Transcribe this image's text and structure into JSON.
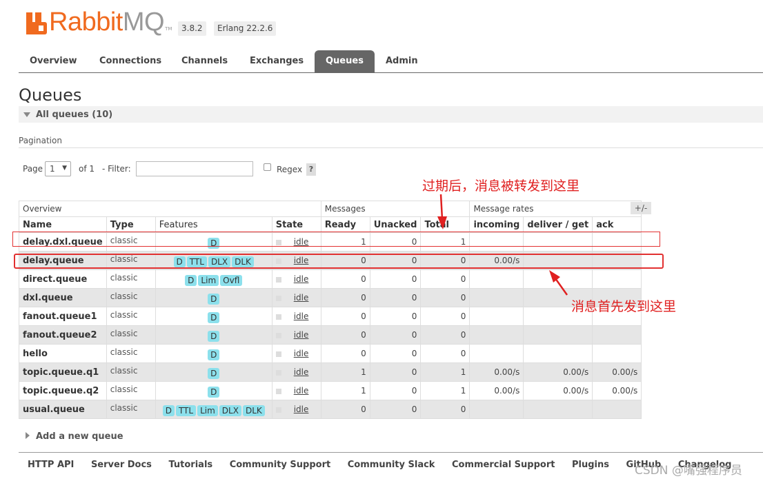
{
  "header": {
    "logo_rabbit": "Rabbit",
    "logo_mq": "MQ",
    "logo_tm": "TM",
    "version": "3.8.2",
    "erlang": "Erlang 22.2.6"
  },
  "tabs": [
    "Overview",
    "Connections",
    "Channels",
    "Exchanges",
    "Queues",
    "Admin"
  ],
  "active_tab": "Queues",
  "page_title": "Queues",
  "section": {
    "title": "All queues (10)"
  },
  "pagination": {
    "label": "Pagination",
    "page_label": "Page",
    "page_value": "1",
    "of_label": "of 1",
    "filter_label": "- Filter:",
    "filter_value": "",
    "regex_label": "Regex",
    "help": "?"
  },
  "table": {
    "groups": [
      "Overview",
      "Messages",
      "Message rates"
    ],
    "plus_minus": "+/-",
    "headers": [
      "Name",
      "Type",
      "Features",
      "State",
      "Ready",
      "Unacked",
      "Total",
      "incoming",
      "deliver / get",
      "ack"
    ],
    "rows": [
      {
        "name": "delay.dxl.queue",
        "type": "classic",
        "features": [
          "D"
        ],
        "state": "idle",
        "ready": "1",
        "unacked": "0",
        "total": "1",
        "incoming": "",
        "deliver": "",
        "ack": ""
      },
      {
        "name": "delay.queue",
        "type": "classic",
        "features": [
          "D",
          "TTL",
          "DLX",
          "DLK"
        ],
        "state": "idle",
        "ready": "0",
        "unacked": "0",
        "total": "0",
        "incoming": "0.00/s",
        "deliver": "",
        "ack": ""
      },
      {
        "name": "direct.queue",
        "type": "classic",
        "features": [
          "D",
          "Lim",
          "Ovfl"
        ],
        "state": "idle",
        "ready": "0",
        "unacked": "0",
        "total": "0",
        "incoming": "",
        "deliver": "",
        "ack": ""
      },
      {
        "name": "dxl.queue",
        "type": "classic",
        "features": [
          "D"
        ],
        "state": "idle",
        "ready": "0",
        "unacked": "0",
        "total": "0",
        "incoming": "",
        "deliver": "",
        "ack": ""
      },
      {
        "name": "fanout.queue1",
        "type": "classic",
        "features": [
          "D"
        ],
        "state": "idle",
        "ready": "0",
        "unacked": "0",
        "total": "0",
        "incoming": "",
        "deliver": "",
        "ack": ""
      },
      {
        "name": "fanout.queue2",
        "type": "classic",
        "features": [
          "D"
        ],
        "state": "idle",
        "ready": "0",
        "unacked": "0",
        "total": "0",
        "incoming": "",
        "deliver": "",
        "ack": ""
      },
      {
        "name": "hello",
        "type": "classic",
        "features": [
          "D"
        ],
        "state": "idle",
        "ready": "0",
        "unacked": "0",
        "total": "0",
        "incoming": "",
        "deliver": "",
        "ack": ""
      },
      {
        "name": "topic.queue.q1",
        "type": "classic",
        "features": [
          "D"
        ],
        "state": "idle",
        "ready": "1",
        "unacked": "0",
        "total": "1",
        "incoming": "0.00/s",
        "deliver": "0.00/s",
        "ack": "0.00/s"
      },
      {
        "name": "topic.queue.q2",
        "type": "classic",
        "features": [
          "D"
        ],
        "state": "idle",
        "ready": "1",
        "unacked": "0",
        "total": "1",
        "incoming": "0.00/s",
        "deliver": "0.00/s",
        "ack": "0.00/s"
      },
      {
        "name": "usual.queue",
        "type": "classic",
        "features": [
          "D",
          "TTL",
          "Lim",
          "DLX",
          "DLK"
        ],
        "state": "idle",
        "ready": "0",
        "unacked": "0",
        "total": "0",
        "incoming": "",
        "deliver": "",
        "ack": ""
      }
    ]
  },
  "annotations": {
    "top": "过期后，消息被转发到这里",
    "bottom": "消息首先发到这里",
    "color": "#e02020"
  },
  "add_queue": "Add a new queue",
  "footer": [
    "HTTP API",
    "Server Docs",
    "Tutorials",
    "Community Support",
    "Community Slack",
    "Commercial Support",
    "Plugins",
    "GitHub",
    "Changelog"
  ],
  "watermark": "CSDN @嘴强程序员"
}
